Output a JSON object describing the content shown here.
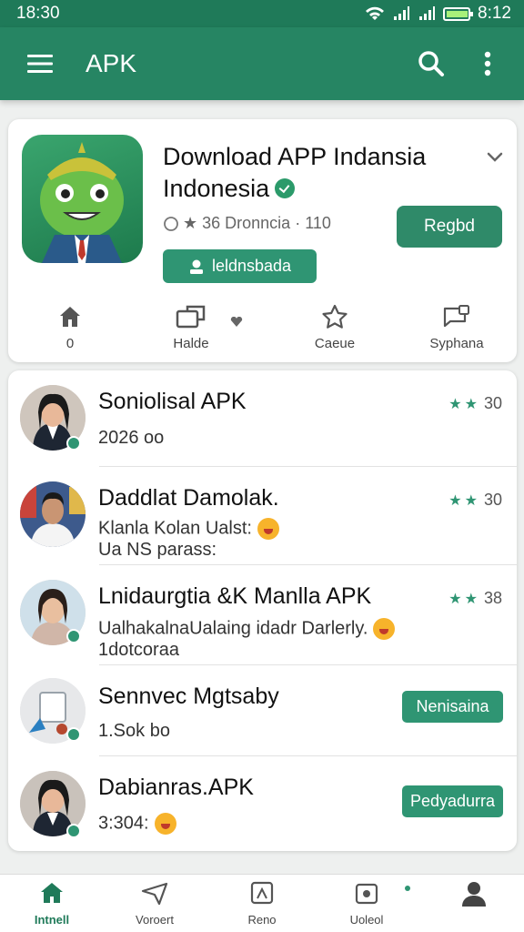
{
  "status": {
    "time": "18:30",
    "battery": "8:12",
    "battery_level": 0.9
  },
  "app_bar": {
    "title": "APK"
  },
  "featured": {
    "title_line1": "Download APP Indansia",
    "title_line2": "Indonesia",
    "meta": "★ 36  Dronncia · 110",
    "primary_button": "Regbd",
    "tag_button": "leldnsbada",
    "actions": [
      {
        "label": "0"
      },
      {
        "label": "Halde"
      },
      {
        "label": "Caeue"
      },
      {
        "label": "Syphana"
      }
    ]
  },
  "list": [
    {
      "title": "Soniolisal APK",
      "subtitle": "2026 oo",
      "subtitle2": "",
      "rating": "30",
      "stars": 2,
      "button": ""
    },
    {
      "title": "Daddlat Damolak.",
      "subtitle": "Klanla Kolan Ualst:",
      "subtitle2": "Ua NS parass:",
      "rating": "30",
      "stars": 2,
      "button": ""
    },
    {
      "title": "Lnidaurgtia &K Manlla APK",
      "subtitle": "UalhakalnaUalaing idadr Darlerly.",
      "subtitle2": "1dotcoraa",
      "rating": "38",
      "stars": 2,
      "button": ""
    },
    {
      "title": "Sennvec Mgtsaby",
      "subtitle": "1.Sok bo",
      "subtitle2": "",
      "rating": "",
      "stars": 0,
      "button": "Nenisaina"
    },
    {
      "title": "Dabianras.APK",
      "subtitle": "3:304:",
      "subtitle2": "",
      "rating": "",
      "stars": 0,
      "button": "Pedyadurra"
    }
  ],
  "bottom_nav": [
    {
      "label": "Intnell",
      "icon": "home-icon",
      "active": true
    },
    {
      "label": "Voroert",
      "icon": "send-icon",
      "active": false
    },
    {
      "label": "Reno",
      "icon": "apps-icon",
      "active": false
    },
    {
      "label": "Uoleol",
      "icon": "download-icon",
      "active": false
    },
    {
      "label": "",
      "icon": "profile-icon",
      "active": false
    }
  ],
  "colors": {
    "primary": "#268563",
    "accent": "#2f9573",
    "status_bar": "#1f7a59"
  }
}
